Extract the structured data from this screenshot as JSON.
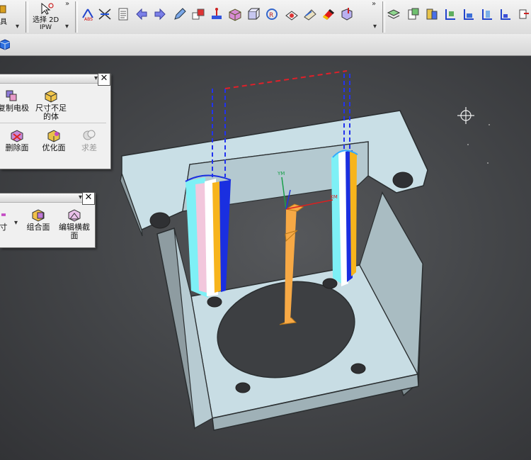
{
  "toolbar": {
    "left_cut_label": "具",
    "select_label_line1": "选择 2D",
    "select_label_line2": "IPW",
    "overflow_glyph": "»",
    "dropdown_glyph": "▾",
    "icons_group1": [
      "abs-icon",
      "trim-icon",
      "list-icon",
      "arrow-left-icon",
      "arrow-right-icon",
      "edit-icon",
      "copy-icon",
      "measure-icon",
      "box-icon",
      "cube-icon",
      "rotate-icon",
      "surface-icon",
      "paint-icon",
      "shade-icon",
      "filter-icon"
    ],
    "icons_group2": [
      "layers-icon",
      "copy2-icon",
      "stack-icon",
      "align-icon",
      "align2-icon",
      "align3-icon",
      "align4-icon",
      "align5-icon"
    ]
  },
  "panel1": {
    "title": "",
    "close": "✕",
    "items": [
      {
        "label": "复制电极",
        "icon": "copy-electrode-icon"
      },
      {
        "label": "尺寸不足的体",
        "label_line1": "尺寸不足",
        "label_line2": "的体",
        "icon": "undersize-body-icon"
      },
      {
        "label": "删除面",
        "icon": "delete-face-icon"
      },
      {
        "label": "优化面",
        "icon": "optimize-face-icon"
      },
      {
        "label": "求差",
        "icon": "subtract-icon"
      }
    ]
  },
  "panel2": {
    "close": "✕",
    "items": [
      {
        "label": "尺寸",
        "label_cut": "寸",
        "icon": "size-icon"
      },
      {
        "label": "组合面",
        "icon": "combine-face-icon"
      },
      {
        "label": "编辑横截面",
        "label_line1": "编辑横截",
        "label_line2": "面",
        "icon": "edit-section-icon"
      }
    ]
  },
  "colors": {
    "part_face": "#c8dfe6",
    "part_shade": "#8f9da2",
    "electrode_orange": "#f7a945",
    "tool_blue": "#1a2fe0",
    "dash_red": "#e0202a",
    "dash_blue": "#2233ee"
  }
}
